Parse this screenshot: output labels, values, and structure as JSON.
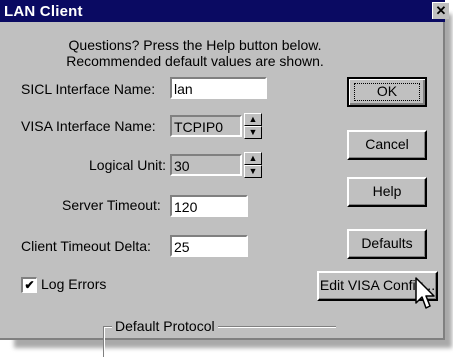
{
  "window": {
    "title": "LAN Client",
    "close": "✕"
  },
  "hint": {
    "line1": "Questions?  Press the Help button below.",
    "line2": "Recommended default values are shown."
  },
  "fields": {
    "sicl_label": "SICL Interface Name:",
    "sicl_value": "lan",
    "visa_label": "VISA Interface Name:",
    "visa_value": "TCPIP0",
    "unit_label": "Logical Unit:",
    "unit_value": "30",
    "server_label": "Server Timeout:",
    "server_value": "120",
    "client_label": "Client Timeout Delta:",
    "client_value": "25"
  },
  "log_errors": {
    "label": "Log Errors",
    "checked": true,
    "mark": "✔"
  },
  "buttons": {
    "ok": "OK",
    "cancel": "Cancel",
    "help": "Help",
    "defaults": "Defaults",
    "edit_visa": "Edit VISA Config..."
  },
  "spin": {
    "up": "▲",
    "down": "▼"
  },
  "group": {
    "label": "Default Protocol"
  }
}
